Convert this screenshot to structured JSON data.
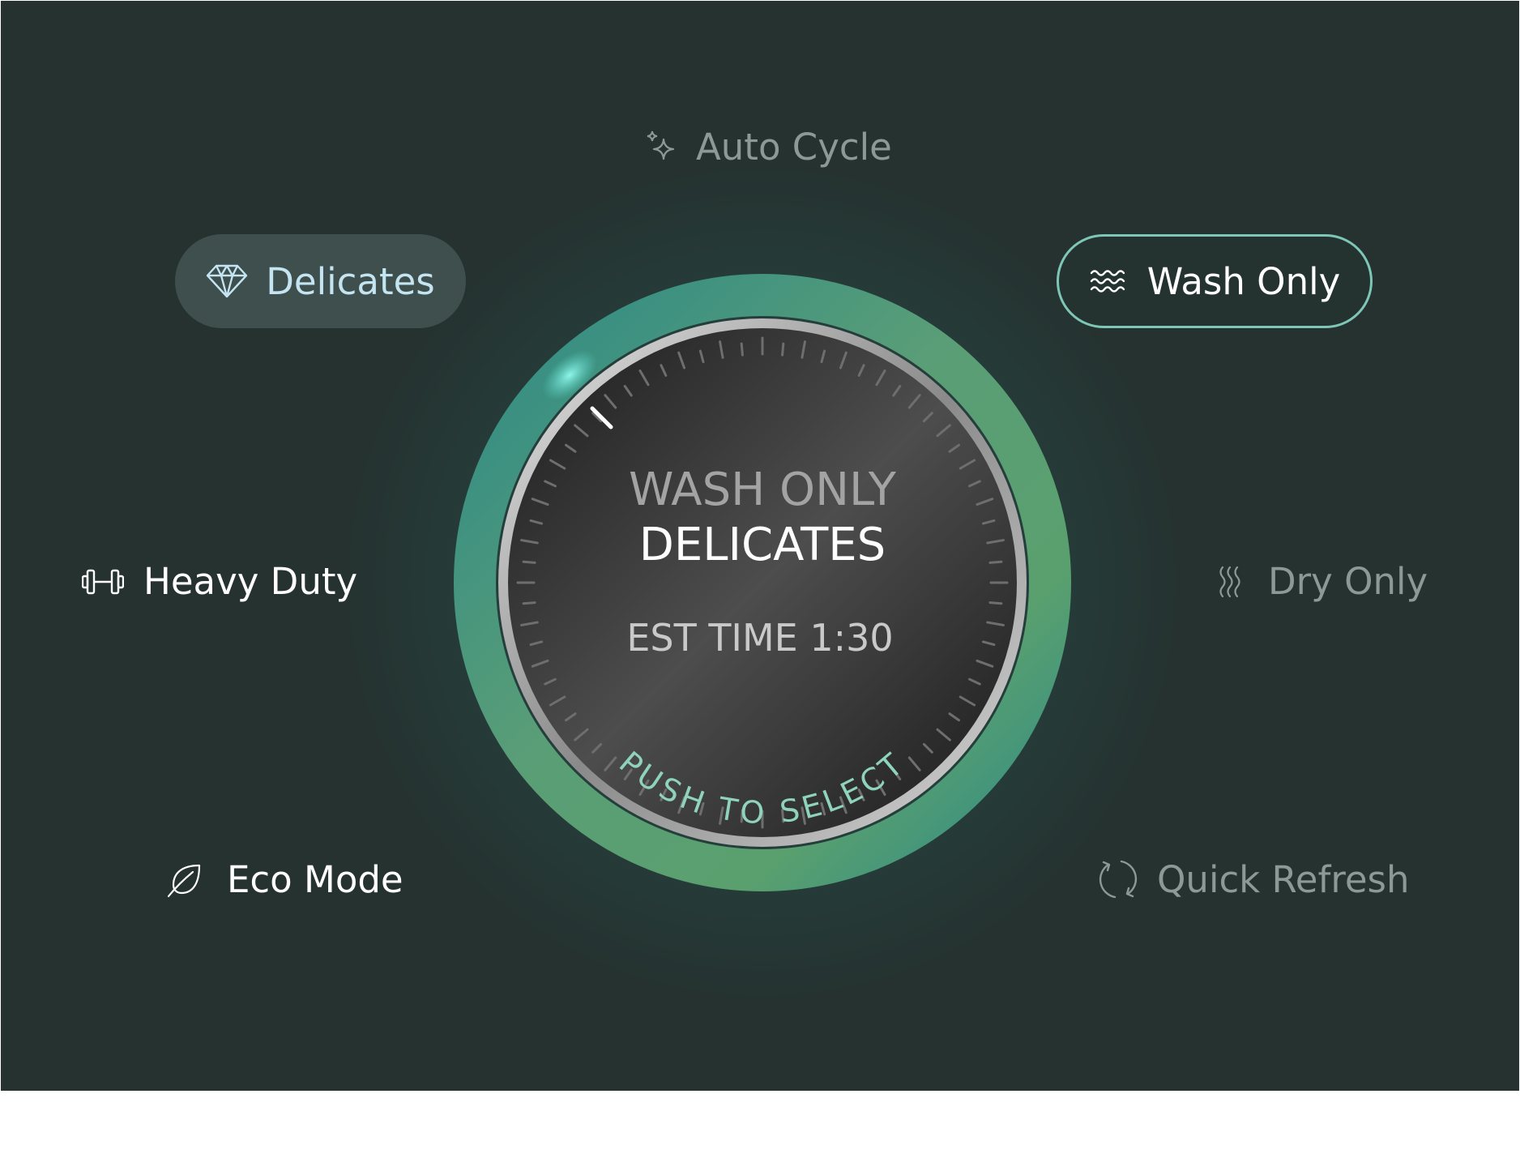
{
  "options": {
    "auto_cycle": "Auto Cycle",
    "delicates": "Delicates",
    "wash_only": "Wash Only",
    "heavy_duty": "Heavy Duty",
    "dry_only": "Dry Only",
    "eco_mode": "Eco Mode",
    "quick_refresh": "Quick Refresh"
  },
  "icons": {
    "auto_cycle": "sparkles-icon",
    "delicates": "diamond-icon",
    "wash_only": "waves-icon",
    "heavy_duty": "dumbbell-icon",
    "dry_only": "heat-waves-icon",
    "eco_mode": "leaf-icon",
    "quick_refresh": "refresh-icon"
  },
  "dial": {
    "line1": "WASH ONLY",
    "line2": "DELICATES",
    "est_time": "EST TIME 1:30",
    "push_label": "PUSH TO SELECT"
  },
  "colors": {
    "background": "#253230",
    "ring_green": "#5aa873",
    "ring_teal": "#2e8a86",
    "highlight": "#6fe3d6",
    "push_label": "#8fd3bd",
    "selected_pill": "#3e4f4d"
  }
}
